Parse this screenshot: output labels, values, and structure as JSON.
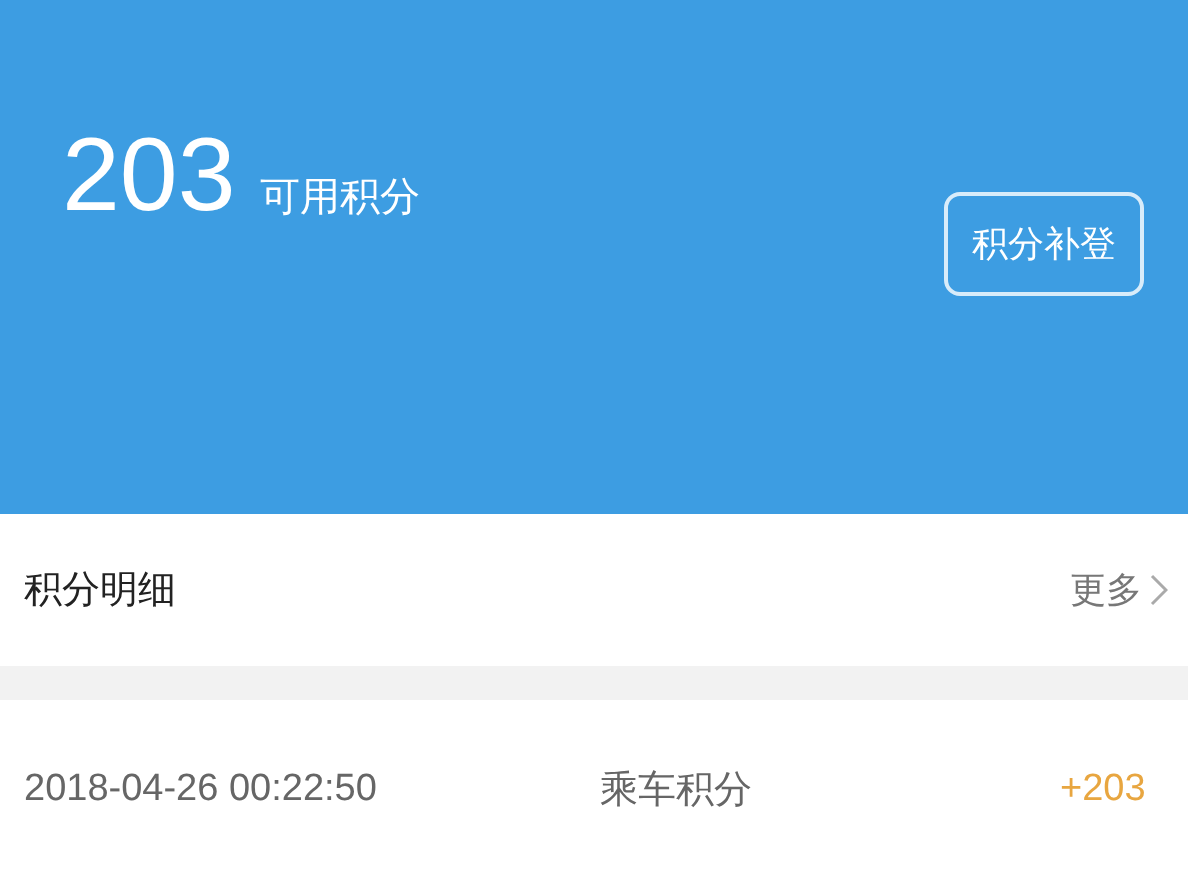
{
  "points": {
    "value": "203",
    "label": "可用积分"
  },
  "supplement_button": "积分补登",
  "detail_header": {
    "title": "积分明细",
    "more": "更多"
  },
  "records": [
    {
      "time": "2018-04-26 00:22:50",
      "type": "乘车积分",
      "amount": "+203"
    }
  ]
}
